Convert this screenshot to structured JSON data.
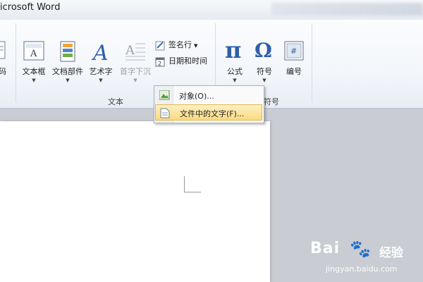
{
  "window": {
    "title": "icrosoft Word"
  },
  "ribbon": {
    "left_cut_label": "码",
    "text_group": {
      "label": "文本",
      "textbox": "文本框",
      "quickparts": "文档部件",
      "wordart": "艺术字",
      "dropcap": "首字下沉",
      "signature": "签名行",
      "datetime": "日期和时间",
      "object": "对象"
    },
    "symbol_group": {
      "label_fragment": "符号",
      "equation": "公式",
      "symbol": "符号",
      "number": "编号"
    }
  },
  "object_menu": {
    "items": [
      {
        "label": "对象(O)...",
        "icon": "insert-object-icon"
      },
      {
        "label": "文件中的文字(F)...",
        "icon": "text-from-file-icon",
        "highlighted": true
      }
    ]
  },
  "watermark": {
    "brand": "Bai",
    "brand2": "经验",
    "url": "jingyan.baidu.com"
  },
  "colors": {
    "ribbon_bg": "#f3f6fa",
    "highlight": "#fbdb80",
    "workspace": "#c9ccd2"
  }
}
